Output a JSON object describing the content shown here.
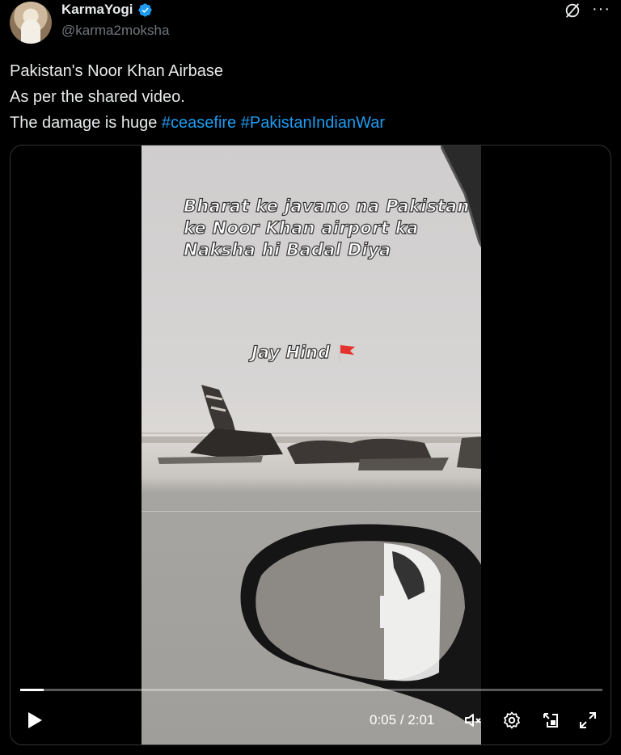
{
  "post": {
    "author": {
      "display_name": "KarmaYogi",
      "handle": "@karma2moksha",
      "verified": true
    },
    "text_lines": [
      "Pakistan's Noor Khan Airbase",
      "As per the shared video.",
      "The damage is huge"
    ],
    "hashtags": [
      "#ceasefire",
      "#PakistanIndianWar"
    ]
  },
  "media": {
    "overlay_caption": "Bharat ke javano na Pakistan ke Noor Khan airport  ka Naksha hi Badal Diya",
    "overlay_tag": "Jay Hind",
    "player": {
      "current_time": "0:05",
      "separator": " / ",
      "duration": "2:01",
      "progress": 0.04,
      "muted": true
    }
  },
  "icons": {
    "verified": "verified-badge-icon",
    "grok": "grok-icon",
    "more": "more-options-icon",
    "play": "play-icon",
    "mute": "muted-speaker-icon",
    "settings": "settings-gear-icon",
    "pip": "picture-in-picture-icon",
    "fullscreen": "fullscreen-icon"
  },
  "colors": {
    "background": "#000000",
    "text": "#e7e9ea",
    "secondary_text": "#71767b",
    "link": "#1d9bf0",
    "verified": "#1d9bf0"
  }
}
